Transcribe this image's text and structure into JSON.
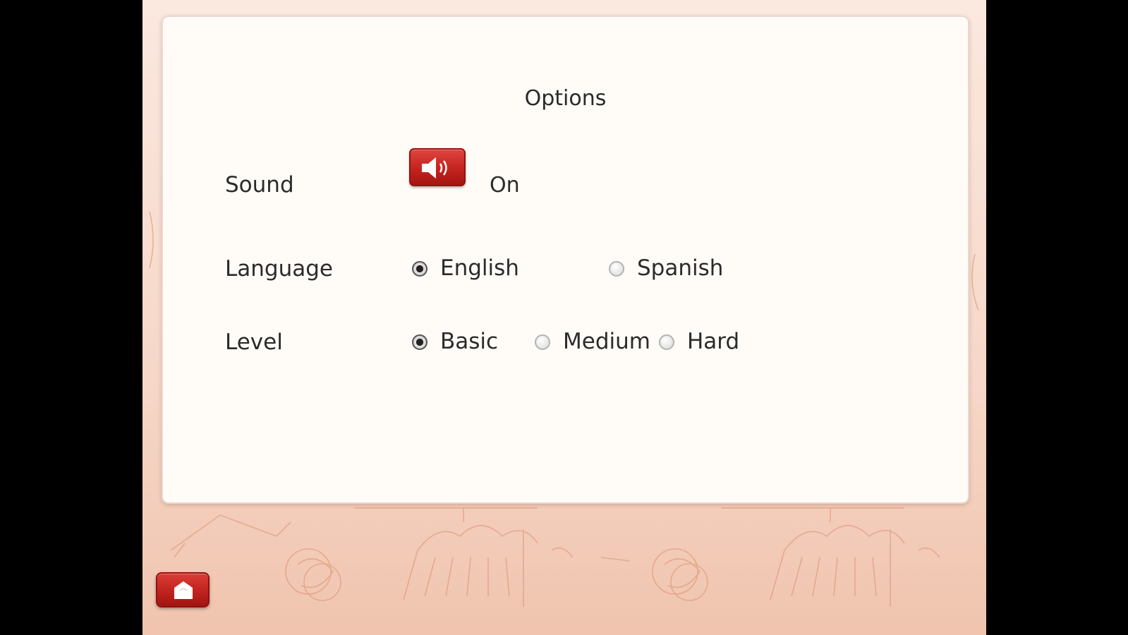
{
  "options": {
    "title": "Options",
    "sound": {
      "label": "Sound",
      "button_icon": "speaker-icon",
      "status": "On"
    },
    "language": {
      "label": "Language",
      "choices": [
        "English",
        "Spanish"
      ],
      "selected": "English"
    },
    "level": {
      "label": "Level",
      "choices": [
        "Basic",
        "Medium",
        "Hard"
      ],
      "selected": "Basic"
    }
  },
  "footer": {
    "home_button_icon": "home-icon"
  },
  "colors": {
    "accent_red": "#c4231f",
    "panel_bg": "#fffcf7",
    "background": "#f6d7c8",
    "letterbox": "#000000"
  }
}
